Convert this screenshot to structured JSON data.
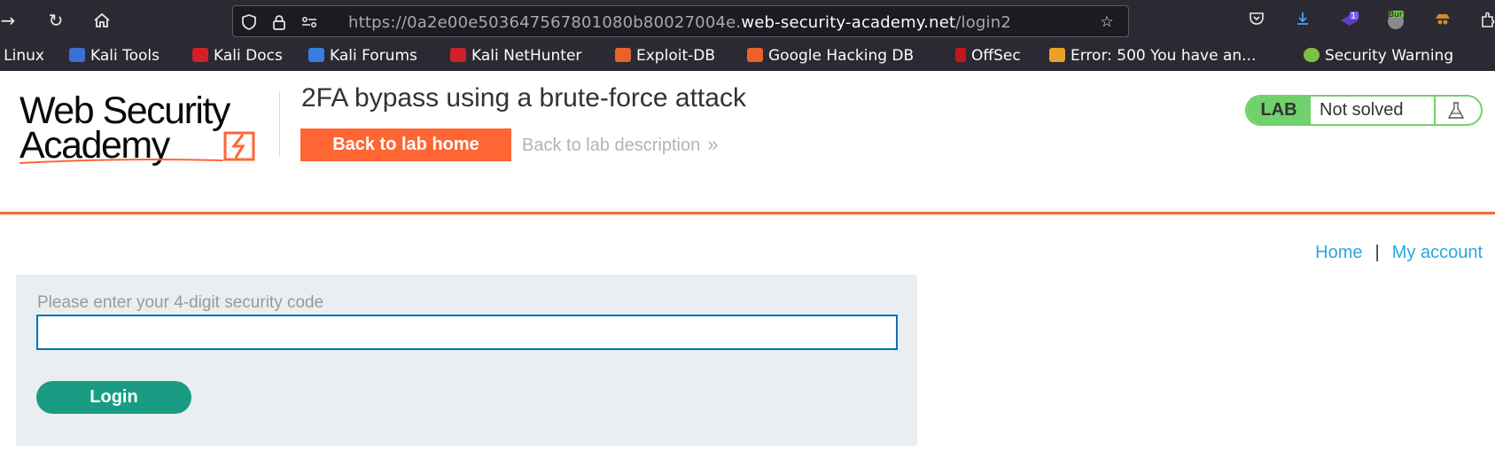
{
  "browser": {
    "url_prefix": "https://0a2e00e503647567801080b80027004e.",
    "url_domain": "web-security-academy.net",
    "url_path": "/login2",
    "extension_badge": "1",
    "extension_label": "Bur"
  },
  "bookmarks": [
    {
      "label": "i Linux",
      "color": "#2b2a33"
    },
    {
      "label": "Kali Tools",
      "color": "#3b6fd8"
    },
    {
      "label": "Kali Docs",
      "color": "#d0202a"
    },
    {
      "label": "Kali Forums",
      "color": "#3a7de0"
    },
    {
      "label": "Kali NetHunter",
      "color": "#d0202a"
    },
    {
      "label": "Exploit-DB",
      "color": "#e8622a"
    },
    {
      "label": "Google Hacking DB",
      "color": "#e8622a"
    },
    {
      "label": "OffSec",
      "color": "#c4161c"
    },
    {
      "label": "Error: 500 You have an...",
      "color": "#e9a12a"
    },
    {
      "label": "Security Warning",
      "color": "#7cc142"
    }
  ],
  "logo": {
    "line1": "Web Security",
    "line2": "Academy"
  },
  "lab": {
    "title": "2FA bypass using a brute-force attack",
    "back_home": "Back to lab home",
    "back_description": "Back to lab description",
    "status_tag": "LAB",
    "status_text": "Not solved"
  },
  "nav": {
    "home": "Home",
    "separator": "|",
    "account": "My account"
  },
  "form": {
    "label": "Please enter your 4-digit security code",
    "value": "",
    "login": "Login"
  },
  "colors": {
    "accent": "#ff6633",
    "login_button": "#1a9c84",
    "status_green": "#70d16d",
    "link": "#29a8e0"
  }
}
